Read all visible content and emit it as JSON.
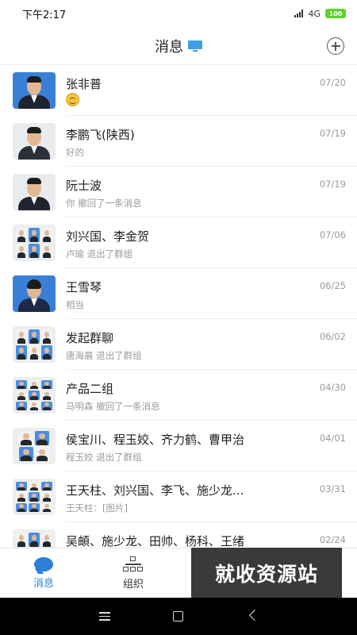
{
  "status_bar": {
    "time": "下午2:17",
    "network": "4G",
    "battery": "100"
  },
  "header": {
    "title": "消息",
    "icon": "monitor-icon",
    "add_icon": "plus-circle-icon"
  },
  "conversations": [
    {
      "name": "张非普",
      "preview": "",
      "preview_icon": "grin-emoji-icon",
      "date": "07/20",
      "avatar": "photo"
    },
    {
      "name": "李鹏飞(陕西)",
      "preview": "好的",
      "date": "07/19",
      "avatar": "photo"
    },
    {
      "name": "阮士波",
      "preview": "你 撤回了一条消息",
      "date": "07/19",
      "avatar": "photo"
    },
    {
      "name": "刘兴国、李金贺",
      "preview": "卢瑜 退出了群组",
      "date": "07/06",
      "avatar": "group"
    },
    {
      "name": "王雪琴",
      "preview": "相当",
      "date": "06/25",
      "avatar": "photo"
    },
    {
      "name": "发起群聊",
      "preview": "唐海晨 退出了群组",
      "date": "06/02",
      "avatar": "group"
    },
    {
      "name": "产品二组",
      "preview": "马明森 撤回了一条消息",
      "date": "04/30",
      "avatar": "group"
    },
    {
      "name": "侯宝川、程玉姣、齐力鹤、曹甲治",
      "preview": "程玉姣 退出了群组",
      "date": "04/01",
      "avatar": "group"
    },
    {
      "name": "王天柱、刘兴国、李飞、施少龙...",
      "preview": "王天柱：[图片]",
      "date": "03/31",
      "avatar": "group"
    },
    {
      "name": "吴頔、施少龙、田帅、杨科、王绪",
      "preview": "",
      "date": "02/24",
      "avatar": "group"
    }
  ],
  "tabbar": {
    "messages_label": "消息",
    "org_label": "组织"
  },
  "watermark": "就收资源站",
  "colors": {
    "accent": "#2e7fd7",
    "avatar_blue": "#3a7fd6"
  }
}
